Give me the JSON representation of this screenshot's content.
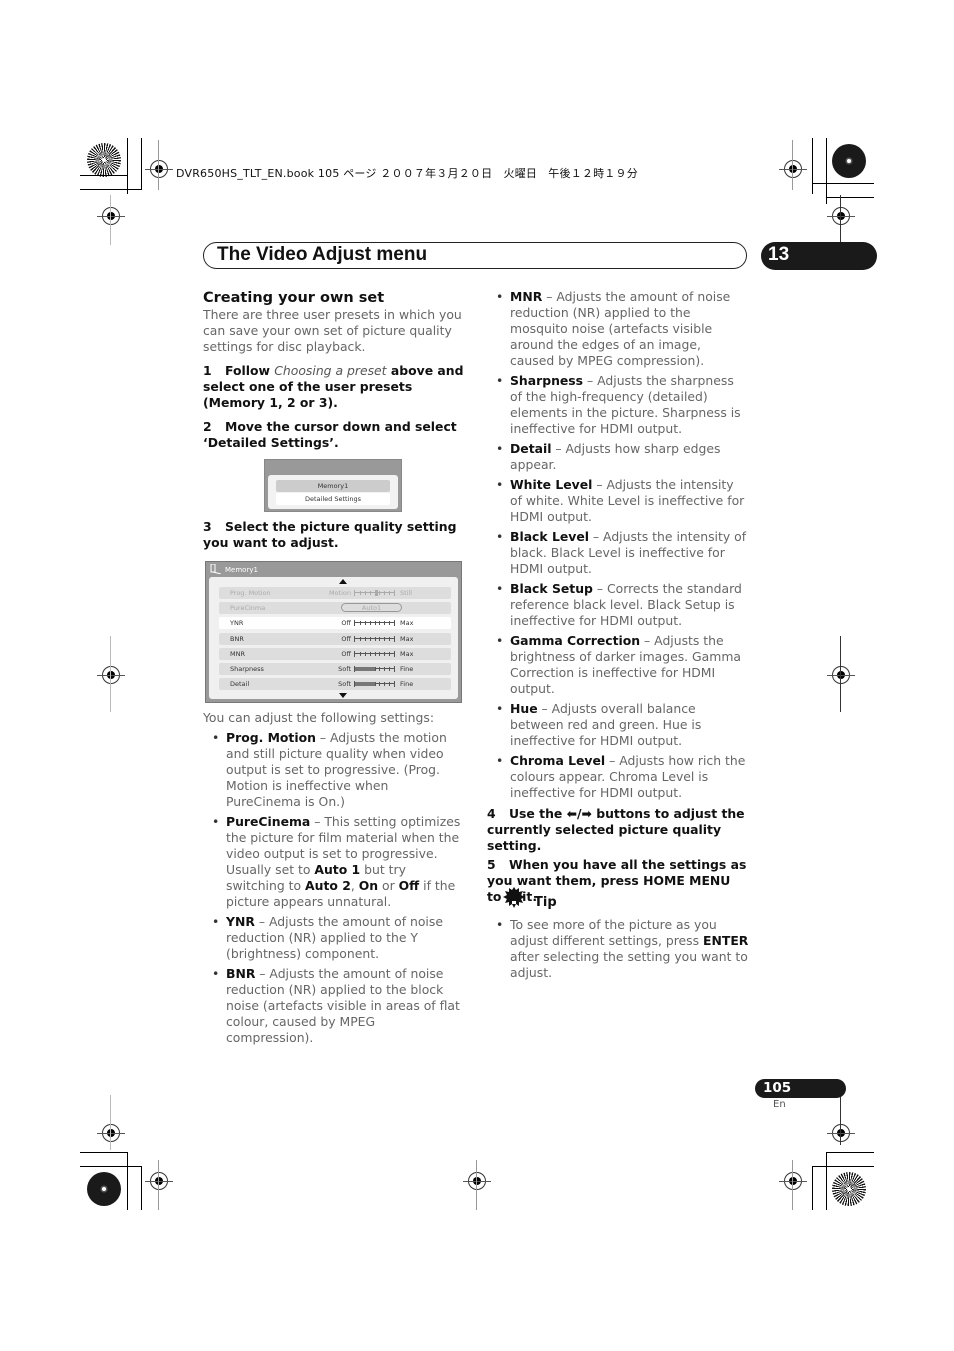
{
  "print_header": {
    "job_line": "DVR650HS_TLT_EN.book  105 ページ  ２００７年３月２０日　火曜日　午後１２時１９分"
  },
  "header": {
    "section_title": "The Video Adjust menu",
    "chapter_number": "13"
  },
  "left_column": {
    "heading": "Creating your own set",
    "intro": "There are three user presets in which you can save your own set of picture quality settings for disc playback.",
    "step1": {
      "num": "1",
      "lead": "Follow",
      "italic": "Choosing a preset",
      "rest": "above and select one of the user presets (Memory 1, 2 or 3)."
    },
    "step2": {
      "num": "2",
      "text": "Move the cursor down and select ‘Detailed Settings’."
    },
    "menu_small": {
      "options": [
        "Memory1",
        "Detailed Settings"
      ],
      "highlighted": "Memory1"
    },
    "step3": {
      "num": "3",
      "text": "Select the picture quality setting you want to adjust."
    },
    "menu_large": {
      "title": "Memory1",
      "rows": [
        {
          "label": "Prog. Motion",
          "low": "Motion",
          "high": "Still",
          "type": "slider",
          "value_fraction": 0.55,
          "state": "disabled"
        },
        {
          "label": "PureCinma",
          "value": "Auto1",
          "type": "pill",
          "state": "disabled"
        },
        {
          "label": "YNR",
          "low": "Off",
          "high": "Max",
          "type": "slider",
          "value_fraction": 0.0,
          "state": "selected"
        },
        {
          "label": "BNR",
          "low": "Off",
          "high": "Max",
          "type": "slider",
          "value_fraction": 0.0,
          "state": "normal"
        },
        {
          "label": "MNR",
          "low": "Off",
          "high": "Max",
          "type": "slider",
          "value_fraction": 0.0,
          "state": "normal"
        },
        {
          "label": "Sharpness",
          "low": "Soft",
          "high": "Fine",
          "type": "slider",
          "value_fraction": 0.5,
          "state": "normal"
        },
        {
          "label": "Detail",
          "low": "Soft",
          "high": "Fine",
          "type": "slider",
          "value_fraction": 0.5,
          "state": "normal"
        }
      ]
    },
    "adjust_intro": "You can adjust the following settings:",
    "bullets": [
      {
        "term": "Prog. Motion",
        "text": " – Adjusts the motion and still picture quality when video output is set to progressive. (Prog. Motion is ineffective when PureCinema is On.)"
      },
      {
        "term": "YNR",
        "text": " – Adjusts the amount of noise reduction (NR) applied to the Y (brightness) component."
      },
      {
        "term": "BNR",
        "text": " – Adjusts the amount of noise reduction (NR) applied to the block noise (artefacts visible in areas of flat colour, caused by MPEG compression)."
      }
    ],
    "purecinema": {
      "term": "PureCinema",
      "t1": " – This setting optimizes the picture for film material when the video output is set to progressive. Usually set to ",
      "b1": "Auto 1",
      "t2": " but try switching to ",
      "b2": "Auto 2",
      "t3": ", ",
      "b3": "On",
      "t4": " or ",
      "b4": "Off",
      "t5": " if the picture appears unnatural."
    }
  },
  "right_column": {
    "bullets": [
      {
        "term": "MNR",
        "text": " – Adjusts the amount of noise reduction (NR) applied to the mosquito noise (artefacts visible around the edges of an image, caused by MPEG compression)."
      },
      {
        "term": "Sharpness",
        "text": " – Adjusts the sharpness of the high-frequency (detailed) elements in the picture. Sharpness is ineffective for HDMI output."
      },
      {
        "term": "Detail",
        "text": " – Adjusts how sharp edges appear."
      },
      {
        "term": "White Level",
        "text": " – Adjusts the intensity of white. White Level is ineffective for HDMI output."
      },
      {
        "term": "Black Level",
        "text": " – Adjusts the intensity of black. Black Level is ineffective for HDMI output."
      },
      {
        "term": "Black Setup",
        "text": " – Corrects the standard reference black level. Black Setup is ineffective for HDMI output."
      },
      {
        "term": "Gamma Correction",
        "text": " – Adjusts the brightness of darker images. Gamma Correction is ineffective for HDMI output."
      },
      {
        "term": "Hue",
        "text": " – Adjusts overall balance between red and green. Hue is ineffective for HDMI output."
      },
      {
        "term": "Chroma Level",
        "text": " – Adjusts how rich the colours appear. Chroma Level is ineffective for HDMI output."
      }
    ],
    "step4": {
      "num": "4",
      "text": "Use the ⬅/➡ buttons to adjust the currently selected picture quality setting."
    },
    "step5": {
      "num": "5",
      "text": "When you have all the settings as you want them, press HOME MENU to exit."
    },
    "tip": {
      "label": "Tip",
      "t1": "To see more of the picture as you adjust different settings, press ",
      "b1": "ENTER",
      "t2": " after selecting the setting you want to adjust."
    }
  },
  "footer": {
    "page_number": "105",
    "language": "En"
  }
}
